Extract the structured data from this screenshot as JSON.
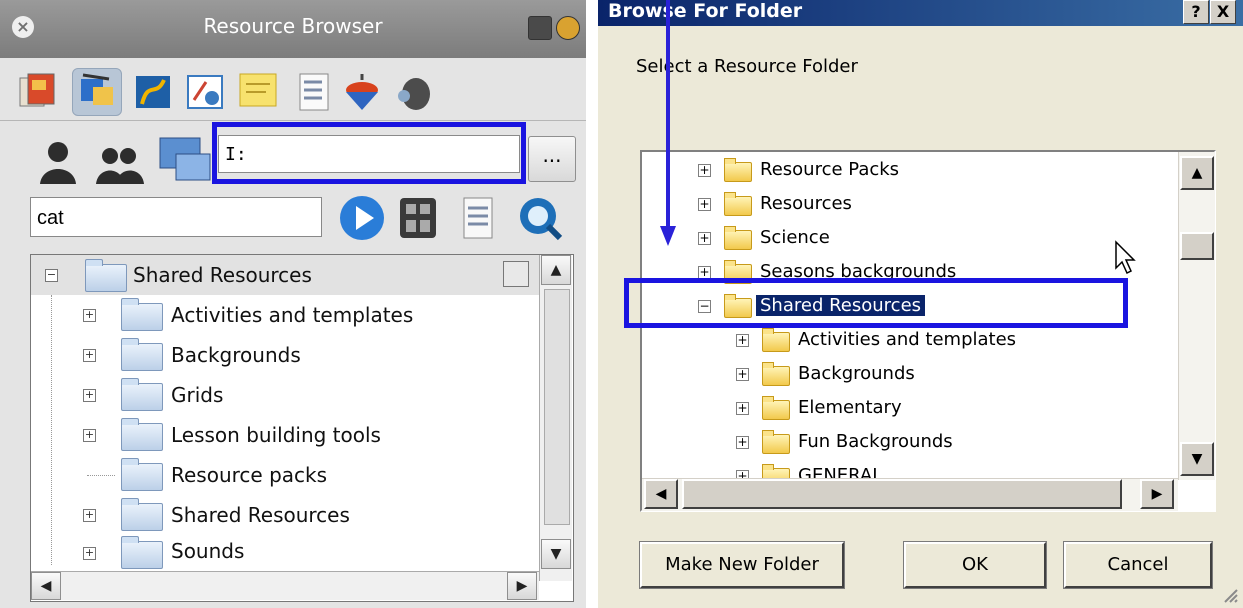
{
  "left_panel": {
    "title": "Resource Browser",
    "path_input_value": "I:",
    "browse_button_label": "...",
    "search_value": "cat",
    "tree": {
      "root_label": "Shared Resources",
      "items": [
        {
          "label": "Activities and templates",
          "expandable": true
        },
        {
          "label": "Backgrounds",
          "expandable": true
        },
        {
          "label": "Grids",
          "expandable": true
        },
        {
          "label": "Lesson building tools",
          "expandable": true
        },
        {
          "label": "Resource packs",
          "expandable": false
        },
        {
          "label": "Shared Resources",
          "expandable": true
        },
        {
          "label": "Sounds",
          "expandable": true
        }
      ]
    },
    "toolbar_icons": [
      "gallery-icon",
      "multimedia-icon",
      "flash-icon",
      "notes-icon",
      "checklist-icon",
      "spinning-top-icon",
      "tools-icon"
    ],
    "colors": {
      "highlight": "#1a14e0",
      "folder": "#bcd0e8"
    }
  },
  "dialog": {
    "title": "Browse For Folder",
    "help_label": "?",
    "close_label": "X",
    "prompt": "Select a Resource Folder",
    "tree": [
      {
        "label": "Resource Packs",
        "expanded": false,
        "level": 0
      },
      {
        "label": "Resources",
        "expanded": false,
        "level": 0
      },
      {
        "label": "Science",
        "expanded": false,
        "level": 0
      },
      {
        "label": "Seasons backgrounds",
        "expanded": false,
        "level": 0
      },
      {
        "label": "Shared Resources",
        "expanded": true,
        "level": 0,
        "selected": true
      },
      {
        "label": "Activities and templates",
        "expanded": false,
        "level": 1
      },
      {
        "label": "Backgrounds",
        "expanded": false,
        "level": 1
      },
      {
        "label": "Elementary",
        "expanded": false,
        "level": 1
      },
      {
        "label": "Fun Backgrounds",
        "expanded": false,
        "level": 1
      },
      {
        "label": "GENERAL",
        "expanded": false,
        "level": 1
      }
    ],
    "buttons": {
      "make_new_folder": "Make New Folder",
      "ok": "OK",
      "cancel": "Cancel"
    },
    "colors": {
      "titlebar": "#0a246a",
      "selection": "#0a246a",
      "highlight": "#1a14e0"
    }
  }
}
